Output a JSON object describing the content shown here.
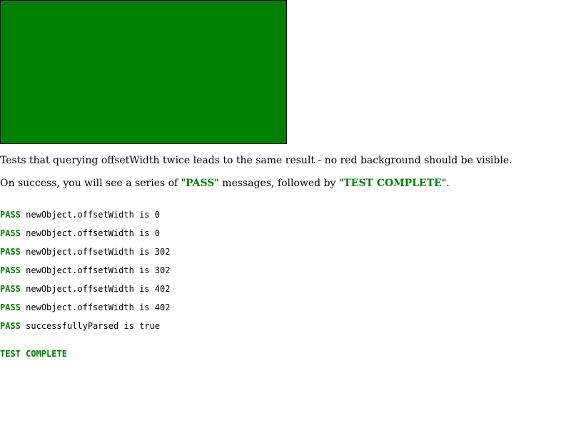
{
  "colors": {
    "box": "#008000",
    "pass": "#008000"
  },
  "description": "Tests that querying offsetWidth twice leads to the same result - no red background should be visible.",
  "success": {
    "prefix": "On success, you will see a series of \"",
    "pass_word": "PASS",
    "middle": "\" messages, followed by \"",
    "complete_word": "TEST COMPLETE",
    "suffix": "\"."
  },
  "console": {
    "lines": [
      {
        "status": "PASS",
        "message": "newObject.offsetWidth is 0"
      },
      {
        "status": "PASS",
        "message": "newObject.offsetWidth is 0"
      },
      {
        "status": "PASS",
        "message": "newObject.offsetWidth is 302"
      },
      {
        "status": "PASS",
        "message": "newObject.offsetWidth is 302"
      },
      {
        "status": "PASS",
        "message": "newObject.offsetWidth is 402"
      },
      {
        "status": "PASS",
        "message": "newObject.offsetWidth is 402"
      },
      {
        "status": "PASS",
        "message": "successfullyParsed is true"
      }
    ],
    "complete": "TEST COMPLETE"
  }
}
